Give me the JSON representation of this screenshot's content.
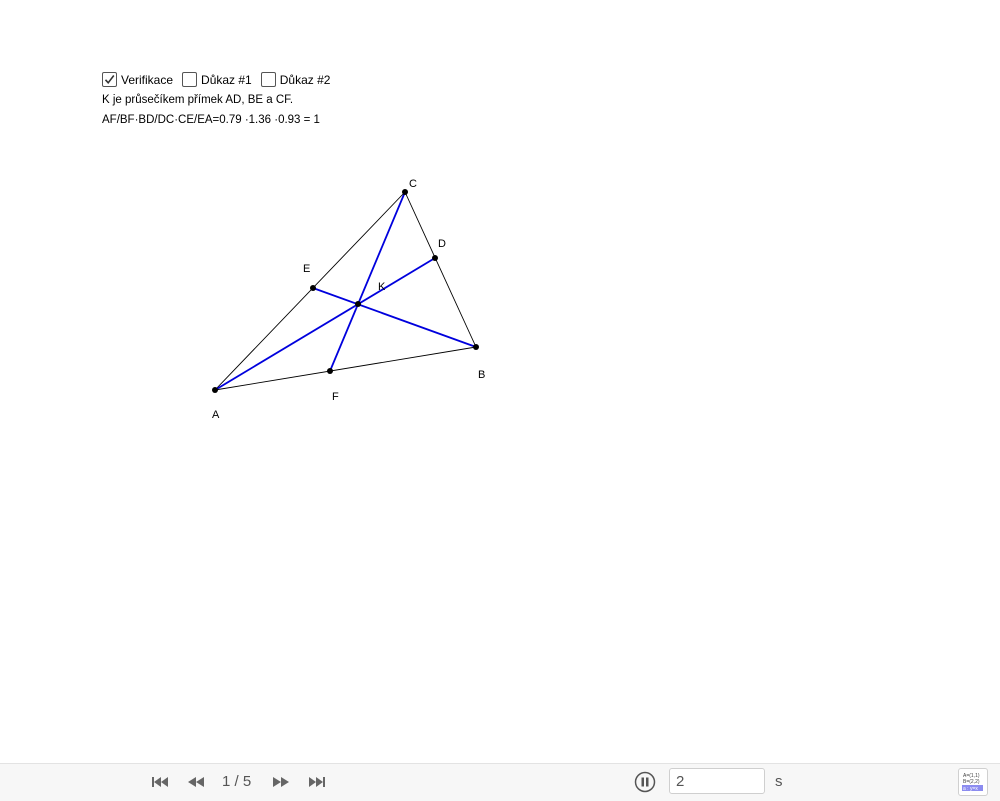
{
  "checkboxes": [
    {
      "label": "Verifikace",
      "checked": true
    },
    {
      "label": "Důkaz #1",
      "checked": false
    },
    {
      "label": "Důkaz #2",
      "checked": false
    }
  ],
  "info": {
    "line1": "K je průsečíkem přímek AD, BE a CF.",
    "line2": "AF/BF·BD/DC·CE/EA=0.79 ·1.36 ·0.93 = 1"
  },
  "points": {
    "A": "A",
    "B": "B",
    "C": "C",
    "D": "D",
    "E": "E",
    "F": "F",
    "K": "K"
  },
  "colors": {
    "cevian": "#0000dd",
    "side": "#000000",
    "point": "#000000"
  },
  "toolbar": {
    "page_counter": "1 / 5",
    "speed_value": "2",
    "speed_unit": "s",
    "icons": {
      "first": "skip-to-start-icon",
      "prev": "rewind-icon",
      "next": "fast-forward-icon",
      "last": "skip-to-end-icon",
      "pause": "pause-icon",
      "algebra": "algebra-view-icon"
    },
    "algebra_icon_text": [
      "A=(1,1)",
      "B=(2,2)",
      "a : y=x"
    ]
  }
}
